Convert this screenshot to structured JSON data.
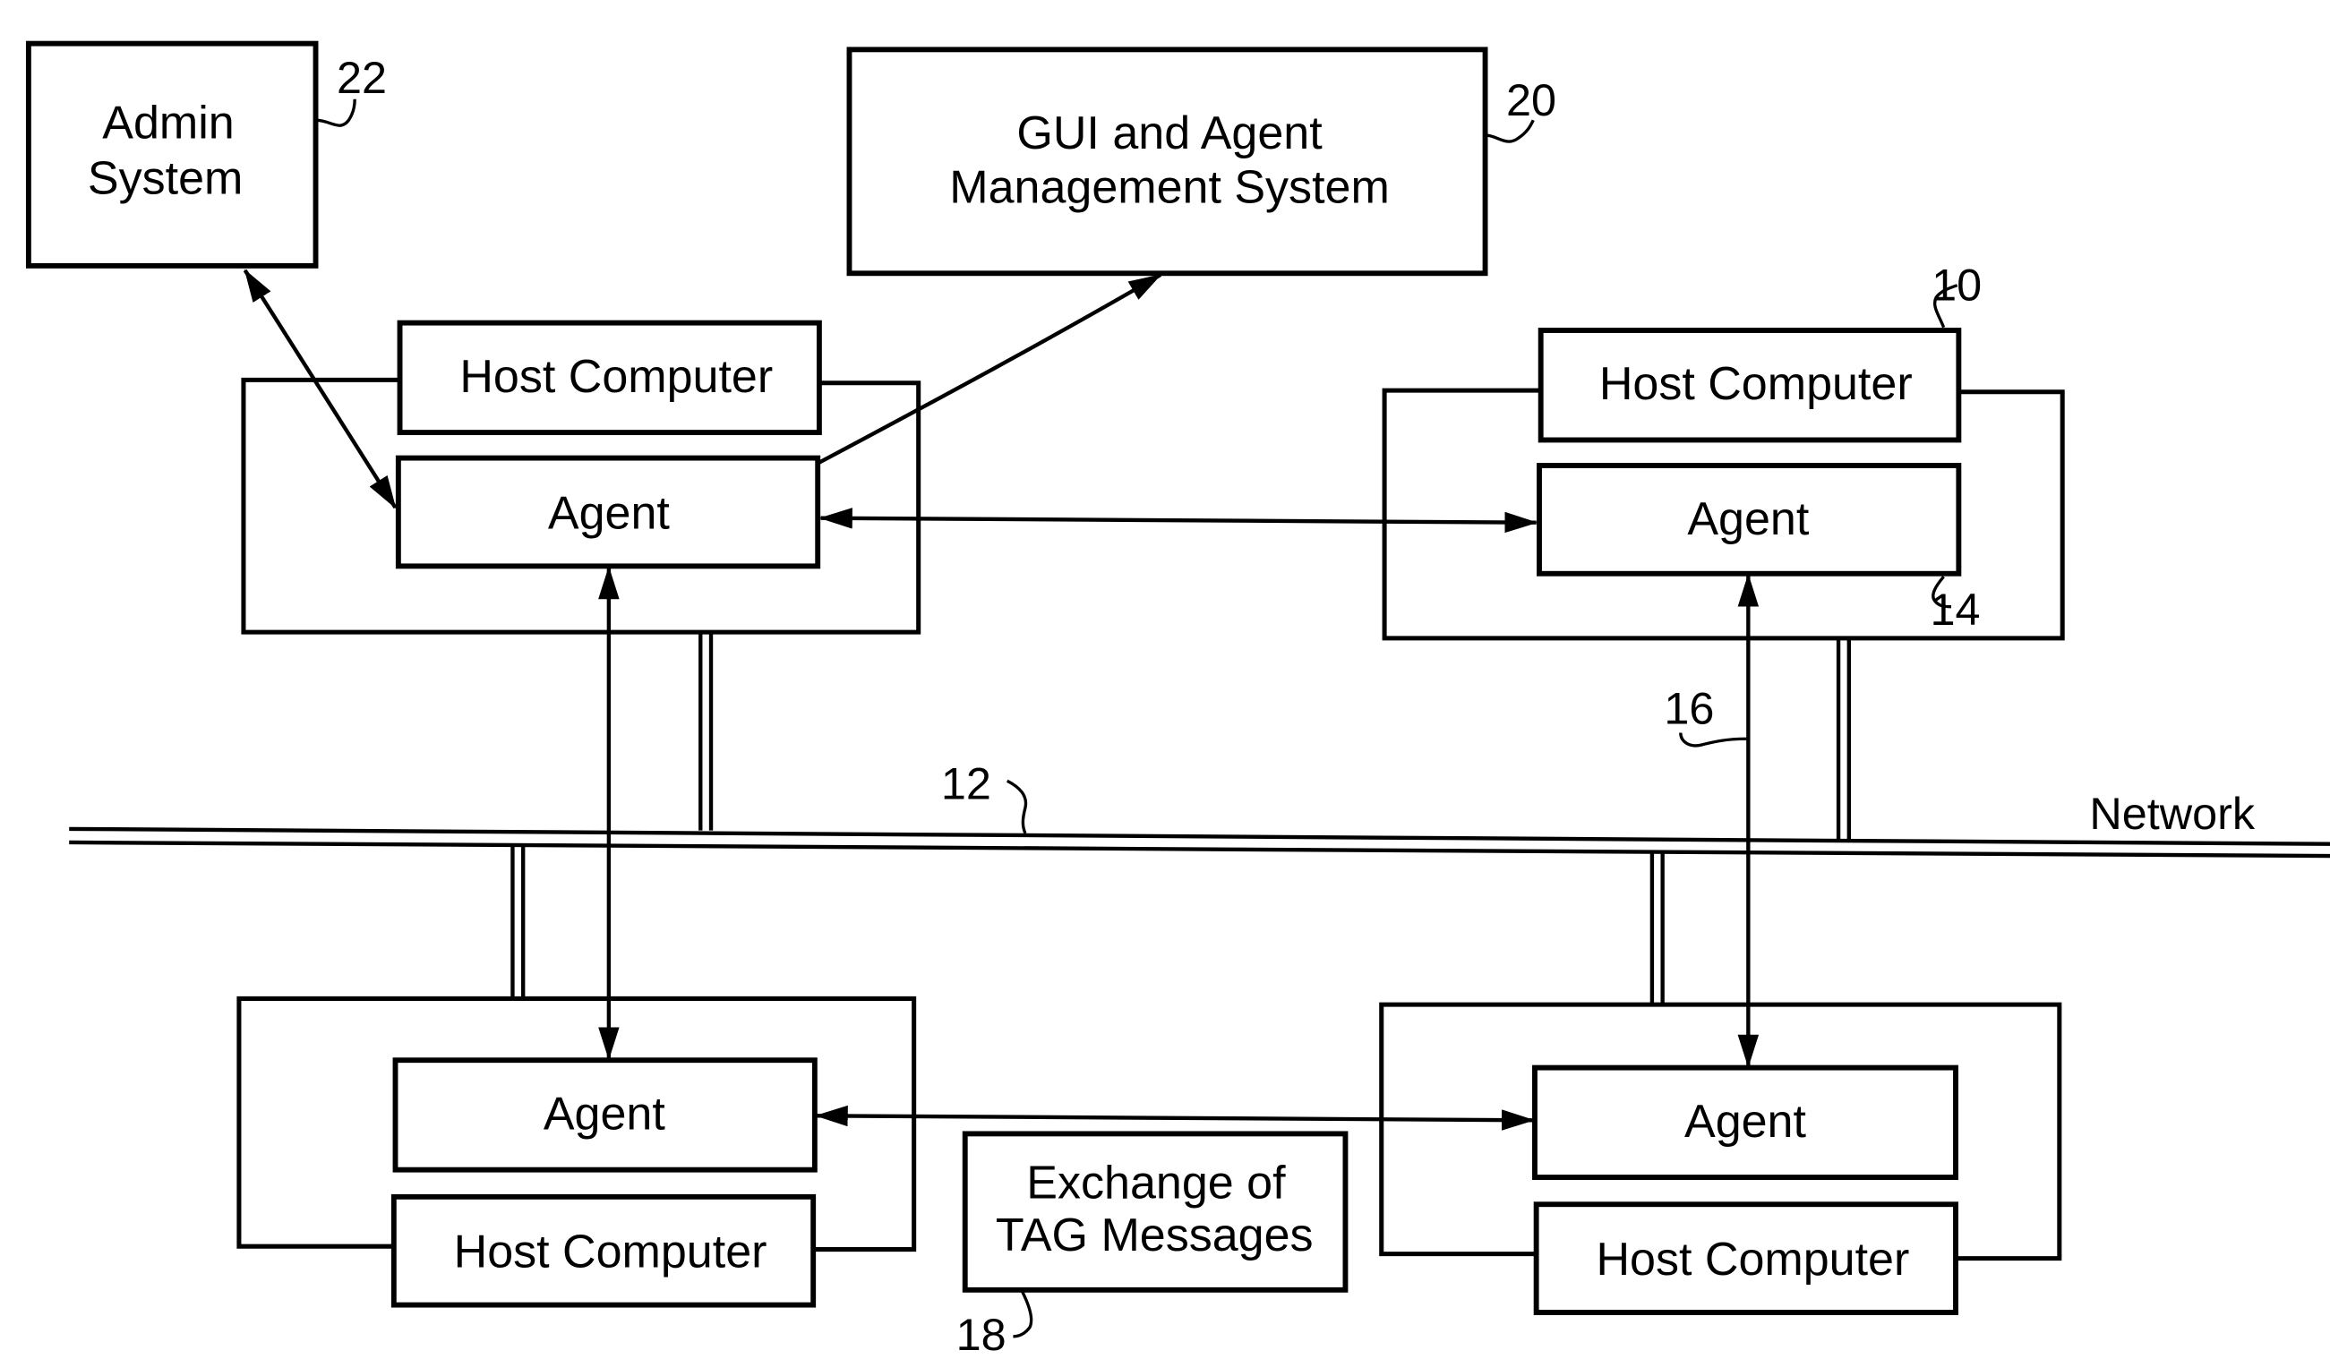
{
  "diagram": {
    "admin_system": {
      "lines": [
        "Admin",
        "System"
      ],
      "ref": "22"
    },
    "gui_system": {
      "lines": [
        "GUI and Agent",
        "Management System"
      ],
      "ref": "20"
    },
    "host_label": "Host Computer",
    "agent_label": "Agent",
    "network_label": "Network",
    "exchange_box": {
      "lines": [
        "Exchange of",
        "TAG Messages"
      ],
      "ref": "18"
    },
    "refs": {
      "host_computer": "10",
      "network": "12",
      "agent": "14",
      "communication_link": "16"
    },
    "colors": {
      "ink": "#000000",
      "paper": "#ffffff"
    }
  }
}
